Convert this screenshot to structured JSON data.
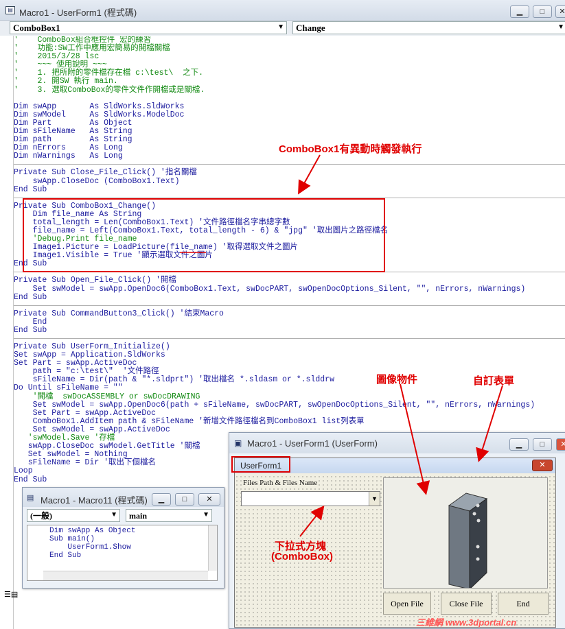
{
  "main_window": {
    "title": "Macro1 - UserForm1 (程式碼)",
    "object_combo": "ComboBox1",
    "proc_combo": "Change"
  },
  "code": {
    "sections": [
      [
        {
          "t": "'    ComboBox組合框控件 宏的練習",
          "c": 1
        },
        {
          "t": "'    功能:SW工作中應用宏簡易的開檔關檔",
          "c": 1
        },
        {
          "t": "'    2015/3/28 lsc",
          "c": 1
        },
        {
          "t": "'    ~~~ 使用說明 ~~~",
          "c": 1
        },
        {
          "t": "'    1. 把所附的零件檔存在檔 c:\\test\\  之下.",
          "c": 1
        },
        {
          "t": "'    2. 開SW 執行 main.",
          "c": 1
        },
        {
          "t": "'    3. 選取ComboBox的零件文件作開檔或是關檔.",
          "c": 1
        },
        {
          "t": "",
          "c": 0
        },
        {
          "t": "Dim swApp       As SldWorks.SldWorks",
          "c": 0
        },
        {
          "t": "Dim swModel     As SldWorks.ModelDoc",
          "c": 0
        },
        {
          "t": "Dim Part        As Object",
          "c": 0
        },
        {
          "t": "Dim sFileName   As String",
          "c": 0
        },
        {
          "t": "Dim path        As String",
          "c": 0
        },
        {
          "t": "Dim nErrors     As Long",
          "c": 0
        },
        {
          "t": "Dim nWarnings   As Long",
          "c": 0
        }
      ],
      [
        {
          "t": "Private Sub Close_File_Click() '指名關檔",
          "c": 0
        },
        {
          "t": "    swApp.CloseDoc (ComboBox1.Text)",
          "c": 0
        },
        {
          "t": "End Sub",
          "c": 0
        }
      ],
      [
        {
          "t": "Private Sub ComboBox1_Change()",
          "c": 0
        },
        {
          "t": "    Dim file_name As String",
          "c": 0
        },
        {
          "t": "    total_length = Len(ComboBox1.Text) '文件路徑檔名字串總字數",
          "c": 0
        },
        {
          "t": "    file_name = Left(ComboBox1.Text, total_length - 6) & \"jpg\" '取出圖片之路徑檔名",
          "c": 0
        },
        {
          "t": "    'Debug.Print file_name",
          "c": 1
        },
        {
          "t": "    Image1.Picture = LoadPicture(file_name) '取得選取文件之圖片",
          "c": 0
        },
        {
          "t": "    Image1.Visible = True '顯示選取文件之圖片",
          "c": 0
        },
        {
          "t": "End Sub",
          "c": 0
        }
      ],
      [
        {
          "t": "Private Sub Open_File_Click() '開檔",
          "c": 0
        },
        {
          "t": "    Set swModel = swApp.OpenDoc6(ComboBox1.Text, swDocPART, swOpenDocOptions_Silent, \"\", nErrors, nWarnings)",
          "c": 0
        },
        {
          "t": "End Sub",
          "c": 0
        }
      ],
      [
        {
          "t": "Private Sub CommandButton3_Click() '結束Macro",
          "c": 0
        },
        {
          "t": "    End",
          "c": 0
        },
        {
          "t": "End Sub",
          "c": 0
        }
      ],
      [
        {
          "t": "Private Sub UserForm_Initialize()",
          "c": 0
        },
        {
          "t": "Set swApp = Application.SldWorks",
          "c": 0
        },
        {
          "t": "Set Part = swApp.ActiveDoc",
          "c": 0
        },
        {
          "t": "    path = \"c:\\test\\\"  '文件路徑",
          "c": 0
        },
        {
          "t": "    sFileName = Dir(path & \"*.sldprt\") '取出檔名 *.sldasm or *.slddrw",
          "c": 0
        },
        {
          "t": "Do Until sFileName = \"\"",
          "c": 0
        },
        {
          "t": "    '開檔  swDocASSEMBLY or swDocDRAWING",
          "c": 1
        },
        {
          "t": "    Set swModel = swApp.OpenDoc6(path + sFileName, swDocPART, swOpenDocOptions_Silent, \"\", nErrors, nWarnings)",
          "c": 0
        },
        {
          "t": "    Set Part = swApp.ActiveDoc",
          "c": 0
        },
        {
          "t": "    ComboBox1.AddItem path & sFileName '新增文件路徑檔名到ComboBox1 list列表單",
          "c": 0
        },
        {
          "t": "    Set swModel = swApp.ActiveDoc",
          "c": 0
        },
        {
          "t": "   'swModel.Save '存檔",
          "c": 1
        },
        {
          "t": "   swApp.CloseDoc swModel.GetTitle '關檔",
          "c": 0
        },
        {
          "t": "   Set swModel = Nothing",
          "c": 0
        },
        {
          "t": "   sFileName = Dir '取出下個檔名",
          "c": 0
        },
        {
          "t": "Loop",
          "c": 0
        },
        {
          "t": "End Sub",
          "c": 0
        }
      ]
    ]
  },
  "annotations": {
    "combo_event": "ComboBox1有異動時觸發執行",
    "image_object": "圖像物件",
    "custom_form": "自訂表單",
    "dropdown_1": "下拉式方塊",
    "dropdown_2": "(ComboBox)"
  },
  "macro11_window": {
    "title": "Macro1 - Macro11 (程式碼)",
    "object_combo": "(一般)",
    "proc_combo": "main",
    "code": [
      "Dim swApp As Object",
      "Sub main()",
      "    UserForm1.Show",
      "End Sub"
    ]
  },
  "userform_window": {
    "title": "Macro1 - UserForm1 (UserForm)",
    "form_caption": "UserForm1",
    "label": "Files Path & Files Name",
    "buttons": {
      "open": "Open File",
      "close": "Close File",
      "end": "End"
    }
  },
  "watermark": "三維網 www.3dportal.cn",
  "colors": {
    "accent_red": "#e00000",
    "keyword": "#1b1b9e",
    "comment": "#138a13"
  }
}
